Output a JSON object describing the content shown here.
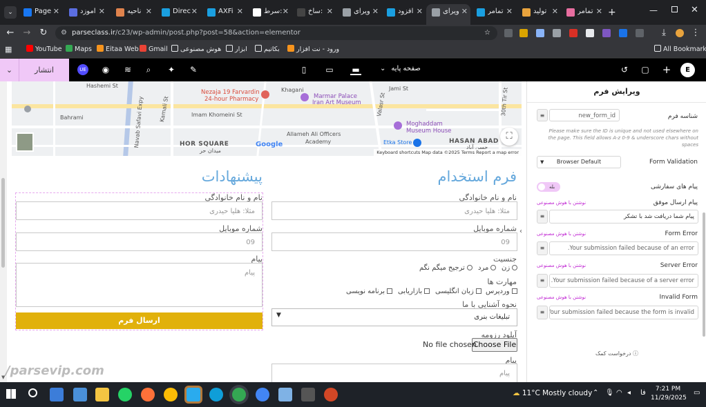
{
  "browser": {
    "tabs": [
      {
        "label": "Page",
        "color": "#1877f2"
      },
      {
        "label": "آموزد",
        "color": "#5b6ee1"
      },
      {
        "label": "ناحیه",
        "color": "#e0834d"
      },
      {
        "label": "Direc",
        "color": "#1a9fe0"
      },
      {
        "label": "AXFi",
        "color": "#1a9fe0"
      },
      {
        "label": "سرط:",
        "color": "#ffffff"
      },
      {
        "label": "ساخ:",
        "color": "#444444"
      },
      {
        "label": "ویرای",
        "color": "#9aa0a6"
      },
      {
        "label": "افزود",
        "color": "#1a9fe0"
      },
      {
        "label": "ویرای",
        "color": "#9aa0a6"
      },
      {
        "label": "تمامر",
        "color": "#1a9fe0"
      },
      {
        "label": "تولید",
        "color": "#e8a33d"
      },
      {
        "label": "تمامر",
        "color": "#e86ea0"
      }
    ],
    "url_host": "parseclass.ir",
    "url_path": "/c23/wp-admin/post.php?post=58&action=elementor",
    "bookmarks": [
      "YouTube",
      "Maps",
      "Eitaa Web",
      "Gmail",
      "هوش مصنوعی",
      "ابزار",
      "بکاتیم",
      "ورود - نت افزار"
    ],
    "all_bookmarks": "All Bookmarks"
  },
  "editor": {
    "publish": "انتشار",
    "ue_badge": "UE",
    "page_selector": "صفحه پایه"
  },
  "map": {
    "labels": [
      "Hashemi St",
      "Bahrami",
      "Imam Khomeini St",
      "Kamali St",
      "HOR SQUARE",
      "میدان حر",
      "Nezaja 19 Farvardin",
      "24-hour Pharmacy",
      "Khagani",
      "Marmar Palace",
      "Iran Art Museum",
      "Jami St",
      "Allameh Ali Officers",
      "Academy",
      "Moghaddam",
      "Museum House",
      "Etka Store",
      "HASAN ABAD",
      "حسن آباد",
      "Valasr St",
      "30th Tir St",
      "Navab Safavi Expy",
      "Google"
    ],
    "footer": "Keyboard shortcuts   Map data ©2025   Terms   Report a map error"
  },
  "form_left": {
    "title": "پیشنهادات",
    "name_label": "نام و نام خانوادگی",
    "name_placeholder": "مثلا: هلیا حیدری",
    "phone_label": "شماره موبایل",
    "phone_placeholder": "09",
    "message_label": "پیام",
    "message_placeholder": "پیام",
    "submit": "ارسال فرم"
  },
  "form_right": {
    "title": "فرم استخدام",
    "name_label": "نام و نام خانوادگی",
    "name_placeholder": "مثلا: هلیا حیدری",
    "phone_label": "شماره موبایل",
    "phone_placeholder": "09",
    "gender_label": "جنسیت",
    "gender_options": [
      "زن",
      "مرد",
      "ترجیح میگم نگم"
    ],
    "skills_label": "مهارت ها",
    "skills_options": [
      "وردپرس",
      "زبان انگلیسی",
      "بازاریابی",
      "برنامه نویسی"
    ],
    "source_label": "نحوه آشنایی با ما",
    "source_value": "تبلیغات بنری",
    "resume_label": "آپلود رزومه",
    "choose_file": "Choose File",
    "no_file": "No file chosen",
    "message_label": "پیام",
    "message_placeholder": "پیام"
  },
  "panel": {
    "title": "ویرایش فرم",
    "form_id_label": "شناسه فرم",
    "form_id_value": "new_form_id",
    "form_id_note": "Please make sure the ID is unique and not used elsewhere on the page. This field allows A-z 0-9 & underscore chars without spaces",
    "validation_label": "Form Validation",
    "validation_value": "Browser Default",
    "custom_messages_label": "پیام های سفارشی",
    "custom_messages_toggle": "بله",
    "ai_link": "نوشتن با هوش مصنوعی",
    "success_label": "پیام ارسال موفق",
    "success_value": "پیام شما دریافت شد با تشکر",
    "form_error_label": "Form Error",
    "form_error_value": "Your submission failed because of an error.",
    "server_error_label": "Server Error",
    "server_error_value": "Your submission failed because of a server error.",
    "invalid_label": "Invalid Form",
    "invalid_value": "Your submission failed because the form is invalid.",
    "help": "درخواست کمک"
  },
  "watermark": "/parsevip.com",
  "taskbar": {
    "weather": "11°C  Mostly cloudy",
    "lang": "فا",
    "time": "7:21 PM",
    "date": "11/29/2025"
  }
}
